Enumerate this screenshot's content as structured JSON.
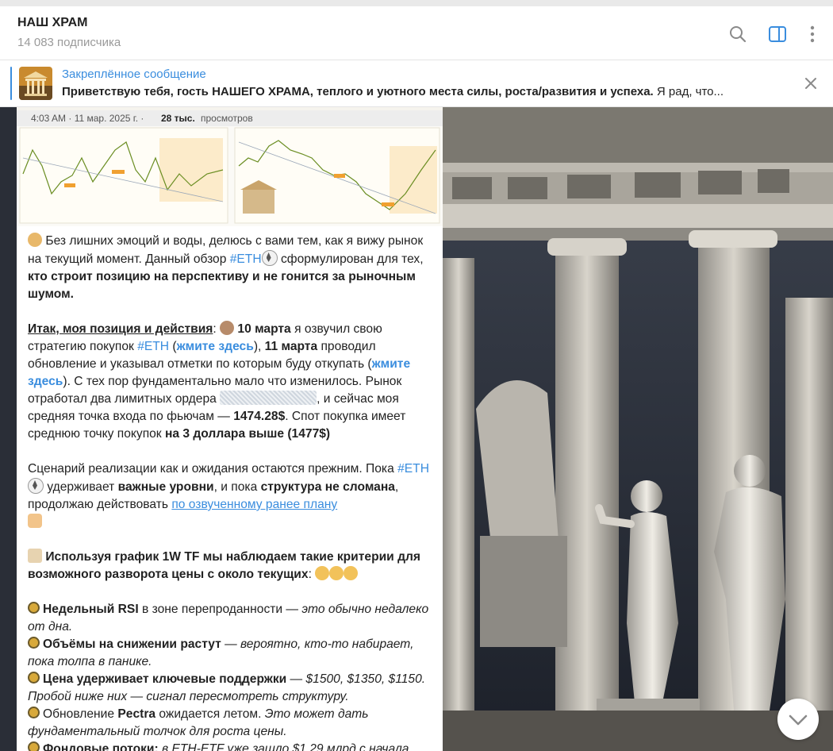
{
  "header": {
    "title": "НАШ ХРАМ",
    "subscribers": "14 083 подписчика",
    "icons": [
      "search-icon",
      "sidebar-toggle-icon",
      "more-vertical-icon"
    ]
  },
  "pinned": {
    "label": "Закреплённое сообщение",
    "text_bold": "Приветствую тебя, гость НАШЕГО ХРАМА, теплого и уютного места силы, роста/развития и успеха.",
    "text_rest": " Я рад, что..."
  },
  "media_bar": {
    "time": "4:03 AM · 11 мар. 2025 г. ·",
    "views_count": "28 тыс.",
    "views_label": "просмотров"
  },
  "message": {
    "p1": {
      "t1": "Без лишних эмоций и воды, делюсь с вами тем, как я вижу рынок на текущий момент. Данный обзор ",
      "tag": "#ETH",
      "t2": " сформулирован для тех, ",
      "b1": "кто строит позицию на перспективу и не гонится за рыночным шумом."
    },
    "p2": {
      "heading": "Итак, моя позиция и действия",
      "colon": ": ",
      "b_date1": "10 марта",
      "t1": " я озвучил свою стратегию покупок ",
      "tag": "#ETH",
      "t2": " (",
      "link1": "жмите здесь",
      "t3": "), ",
      "b_date2": "11 марта",
      "t4": " проводил обновление и указывал отметки по которым буду откупать (",
      "link2": "жмите здесь",
      "t5": "). С тех пор фундаментально мало что изменилось. Рынок отработал два лимитных ордера ",
      "t6": ", и сейчас моя средняя точка входа по фьючам — ",
      "b_price": "1474.28$",
      "t7": ". Спот покупка имеет среднюю точку покупок ",
      "b_spot": "на 3 доллара выше (1477$)"
    },
    "p3": {
      "t1": "Сценарий реализации как и ожидания остаются прежним. Пока ",
      "tag": "#ETH",
      "t2": " удерживает ",
      "b1": "важные уровни",
      "t3": ", и пока ",
      "b2": "структура не сломана",
      "t4": ", продолжаю действовать ",
      "link": "по озвученному ранее плану"
    },
    "p4": {
      "b1": "Используя график 1W TF мы наблюдаем такие критерии для возможного разворота цены с около текущих",
      "t1": ":"
    },
    "criteria": [
      {
        "bold": "Недельный RSI",
        "plain": " в зоне перепроданности — ",
        "italic": "это обычно недалеко от дна."
      },
      {
        "bold": "Объёмы на снижении растут",
        "plain": " — ",
        "italic": "вероятно, кто-то набирает, пока толпа в панике."
      },
      {
        "bold": "Цена удерживает ключевые поддержки",
        "plain": " — ",
        "italic": "$1500, $1350, $1150. Пробой ниже них — сигнал пересмотреть структуру."
      },
      {
        "pre": "Обновление ",
        "bold": "Pectra",
        "plain": " ожидается летом. ",
        "italic": "Это может дать фундаментальный толчок для роста цены."
      },
      {
        "bold": "Фондовые потоки:",
        "plain": " ",
        "italic": "в ETH-ETF уже зашло $1.29 млрд с начала"
      }
    ]
  },
  "colors": {
    "accent": "#3a8dde",
    "header_bg": "#ffffff",
    "text": "#222222",
    "muted": "#9a9a9a"
  }
}
